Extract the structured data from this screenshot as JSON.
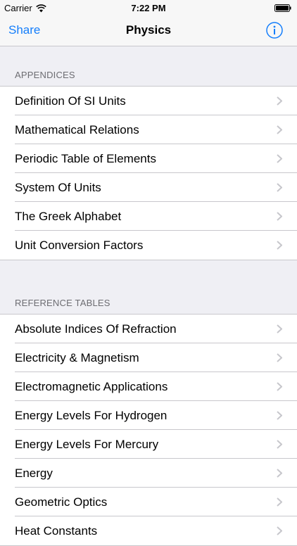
{
  "status_bar": {
    "carrier": "Carrier",
    "time": "7:22 PM"
  },
  "nav": {
    "share_label": "Share",
    "title": "Physics",
    "info_icon": "info-icon"
  },
  "sections": [
    {
      "header": "APPENDICES",
      "items": [
        "Definition Of SI Units",
        "Mathematical Relations",
        "Periodic Table of Elements",
        "System Of Units",
        "The Greek Alphabet",
        "Unit Conversion Factors"
      ]
    },
    {
      "header": "REFERENCE TABLES",
      "items": [
        "Absolute Indices Of Refraction",
        "Electricity & Magnetism",
        "Electromagnetic Applications",
        "Energy Levels For Hydrogen",
        "Energy Levels For Mercury",
        "Energy",
        "Geometric Optics",
        "Heat Constants"
      ]
    }
  ],
  "colors": {
    "accent": "#147efb",
    "background": "#efeff4",
    "separator": "#c8c7cc"
  }
}
